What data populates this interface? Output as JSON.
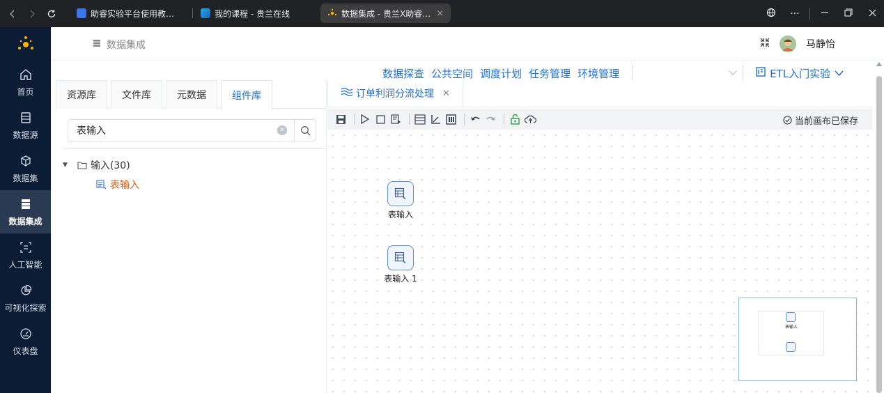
{
  "browser": {
    "tabs": [
      {
        "title": "助睿实验平台使用教…",
        "active": false
      },
      {
        "title": "我的课程 - 贵兰在线",
        "active": false
      },
      {
        "title": "数据集成 - 贵兰X助睿…",
        "active": true
      }
    ],
    "close_glyph": "×",
    "more_glyph": "···"
  },
  "sidebar": {
    "items": [
      {
        "label": "首页",
        "icon": "home-icon"
      },
      {
        "label": "数据源",
        "icon": "database-icon"
      },
      {
        "label": "数据集",
        "icon": "cube-icon"
      },
      {
        "label": "数据集成",
        "icon": "server-icon",
        "active": true
      },
      {
        "label": "人工智能",
        "icon": "scan-icon"
      },
      {
        "label": "可视化探索",
        "icon": "pie-chart-icon"
      },
      {
        "label": "仪表盘",
        "icon": "gauge-icon"
      }
    ]
  },
  "header": {
    "breadcrumb": "数据集成",
    "username": "马静怡"
  },
  "menu": {
    "items": [
      "数据探查",
      "公共空间",
      "调度计划",
      "任务管理",
      "环境管理"
    ],
    "project": "ETL入门实验"
  },
  "left_panel": {
    "tabs": [
      "资源库",
      "文件库",
      "元数据",
      "组件库"
    ],
    "active_tab": 3,
    "search_value": "表输入",
    "tree": {
      "folder": "输入(30)",
      "child": "表输入"
    }
  },
  "editor": {
    "tab_title": "订单利润分流处理",
    "save_status": "当前画布已保存",
    "nodes": [
      "表输入",
      "表输入 1"
    ],
    "minimap_label": "表输入"
  },
  "colors": {
    "accent": "#1f6fd6",
    "sidebar_bg": "#0c1c34",
    "highlight": "#e55a1c"
  }
}
